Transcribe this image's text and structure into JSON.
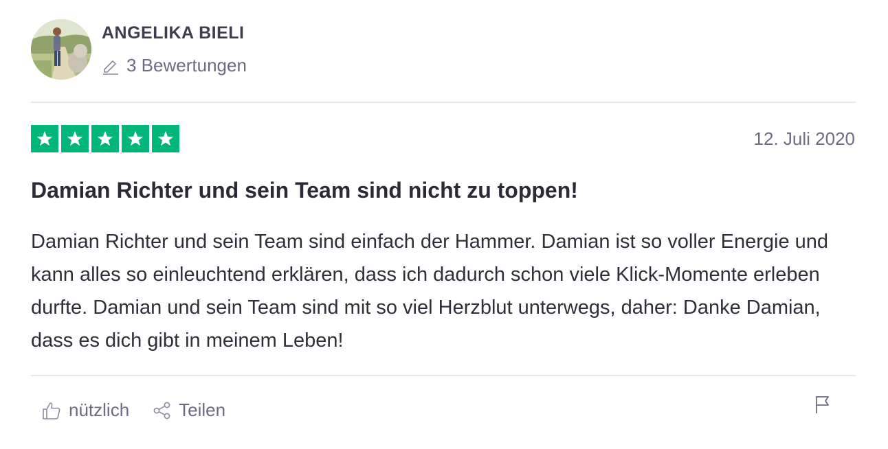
{
  "reviewer": {
    "name": "ANGELIKA BIELI",
    "review_count": "3 Bewertungen",
    "avatar_icon": "reviewer-photo"
  },
  "review": {
    "rating": 5,
    "rating_max": 5,
    "date": "12. Juli 2020",
    "title": "Damian Richter und sein Team sind nicht zu toppen!",
    "text": "Damian Richter und sein Team sind einfach der Hammer. Damian ist so voller Energie und kann alles so einleuchtend erklären, dass ich dadurch schon viele Klick-Momente erleben durfte. Damian und sein Team sind mit so viel Herzblut unterwegs, daher: Danke Damian, dass es dich gibt in meinem Leben!"
  },
  "actions": {
    "helpful_label": "nützlich",
    "share_label": "Teilen",
    "helpful_icon": "thumbs-up-icon",
    "share_icon": "share-icon",
    "flag_icon": "flag-icon"
  },
  "colors": {
    "star_green": "#00b67a",
    "muted_text": "#6b6b84",
    "divider": "#e6e6ee"
  }
}
